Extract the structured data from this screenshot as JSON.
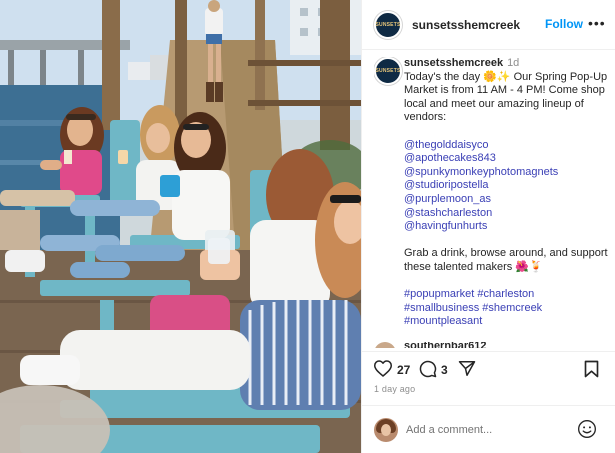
{
  "post": {
    "username": "sunsetsshemcreek",
    "avatar_text": "SUNSETS",
    "follow_label": "Follow",
    "more_label": "•••"
  },
  "caption": {
    "username": "sunsetsshemcreek",
    "age": "1d",
    "intro": "Today's the day 🌼✨ Our Spring Pop-Up Market is from 11 AM - 4 PM! Come shop local and meet our amazing lineup of vendors:",
    "vendors": [
      "@thegolddaisyco",
      "@apothecakes843",
      "@spunkymonkeyphotomagnets",
      "@studioripostella",
      "@purplemoon_as",
      "@stashcharleston",
      "@havingfunhurts"
    ],
    "closing": "Grab a drink, browse around, and support these talented makers 🌺🍹",
    "hashtags": [
      "#popupmarket",
      "#charleston",
      "#smallbusiness",
      "#shemcreek",
      "#mountpleasant"
    ]
  },
  "cut_comment": {
    "username": "southernbar612"
  },
  "actions": {
    "like_count": "27",
    "comment_count": "3",
    "time_ago": "1 day ago"
  },
  "comment_box": {
    "placeholder": "Add a comment..."
  },
  "colors": {
    "link": "#3a3fb5",
    "follow": "#0095f6",
    "muted": "#8e8e8e"
  }
}
